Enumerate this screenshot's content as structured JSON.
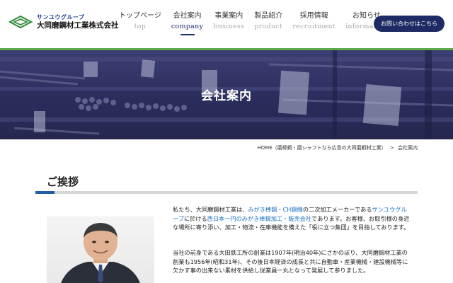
{
  "header": {
    "logo_sub": "サンユウグループ",
    "logo_main": "大同磨鋼材工業株式会社",
    "nav": [
      {
        "ja": "トップページ",
        "en": "top"
      },
      {
        "ja": "会社案内",
        "en": "company"
      },
      {
        "ja": "事業案内",
        "en": "business"
      },
      {
        "ja": "製品紹介",
        "en": "product"
      },
      {
        "ja": "採用情報",
        "en": "recruitment"
      },
      {
        "ja": "お知らせ",
        "en": "information"
      }
    ],
    "contact_label": "お問い合わせはこちら"
  },
  "hero": {
    "title": "会社案内"
  },
  "breadcrumb": {
    "home": "HOME（磨棒鋼・磨シャフトなら広島の大同磨鋼材工業）",
    "separator": ">",
    "current": "会社案内"
  },
  "greeting": {
    "title": "ご挨拶",
    "p1": {
      "a": "私たち、大同磨鋼材工業は、",
      "b": "みがき棒鋼・CH鋼線",
      "c": "の二次加工メーカーである",
      "d": "サンユウグループ",
      "e": "に於ける",
      "f": "西日本一円のみがき棒鋼加工・販売会社",
      "g": "であります。お客様、お取引様の身近な場所に寄り添い、加工・物流・在庫機能を備えた「役に立つ集団」を目指しております。"
    },
    "p2": "当社の前身である大田鉄工所の創業は1907年(明治40年)にさかのぼり、大同磨鋼材工業の創業も1956年(昭和31年)、その後日本経済の成長と共に自動車・産業機械・建設機械等に欠かす事の出来ない素材を供給し従業員一丸となって発展して参りました。"
  },
  "colors": {
    "navy": "#1f2a64",
    "accent_green": "#5fa94a",
    "link_blue": "#1e74c4",
    "rule_blue": "#1e5fa8"
  }
}
